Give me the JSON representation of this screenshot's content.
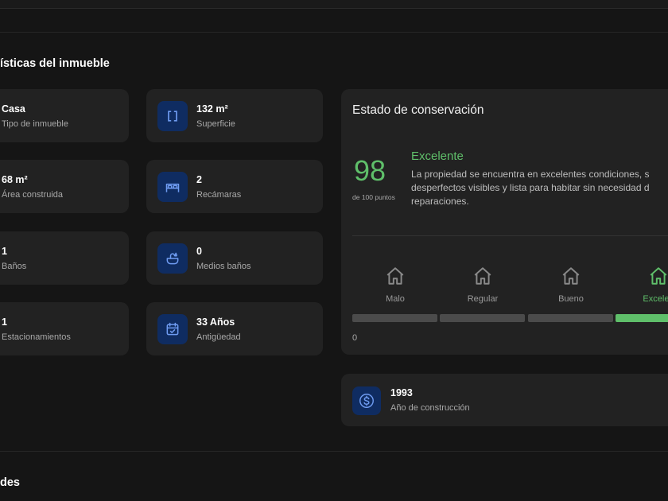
{
  "sections": {
    "features_title": "ísticas del inmueble",
    "next_title": "des"
  },
  "features": [
    {
      "value": "Casa",
      "label": "Tipo de inmueble",
      "icon": "house-icon"
    },
    {
      "value": "132 m²",
      "label": "Superficie",
      "icon": "area-brackets-icon"
    },
    {
      "value": "68 m²",
      "label": "Área construida",
      "icon": "built-area-icon"
    },
    {
      "value": "2",
      "label": "Recámaras",
      "icon": "bed-icon"
    },
    {
      "value": "1",
      "label": "Baños",
      "icon": "bath-icon"
    },
    {
      "value": "0",
      "label": "Medios baños",
      "icon": "washbasin-icon"
    },
    {
      "value": "1",
      "label": "Estacionamientos",
      "icon": "car-icon"
    },
    {
      "value": "33 Años",
      "label": "Antigüedad",
      "icon": "calendar-check-icon"
    }
  ],
  "conservation": {
    "title": "Estado de conservación",
    "score": "98",
    "score_sub": "de 100 puntos",
    "rating": "Excelente",
    "description": "La propiedad se encuentra en excelentes condiciones, s desperfectos visibles y lista para habitar sin necesidad d reparaciones.",
    "levels": [
      {
        "label": "Malo"
      },
      {
        "label": "Regular"
      },
      {
        "label": "Bueno"
      },
      {
        "label": "Excelen"
      }
    ],
    "active_level": 3,
    "scale_min": "0",
    "colors": {
      "active": "#5fbf6a",
      "inactive": "#4b4b4b"
    }
  },
  "construction": {
    "year": "1993",
    "label": "Año de construcción",
    "icon": "dollar-circle-icon"
  },
  "colors": {
    "background": "#151515",
    "card": "#222222",
    "icon_bg": "#0f2c61",
    "icon_fg": "#6f9cf2",
    "accent_green": "#5fbf6a"
  }
}
